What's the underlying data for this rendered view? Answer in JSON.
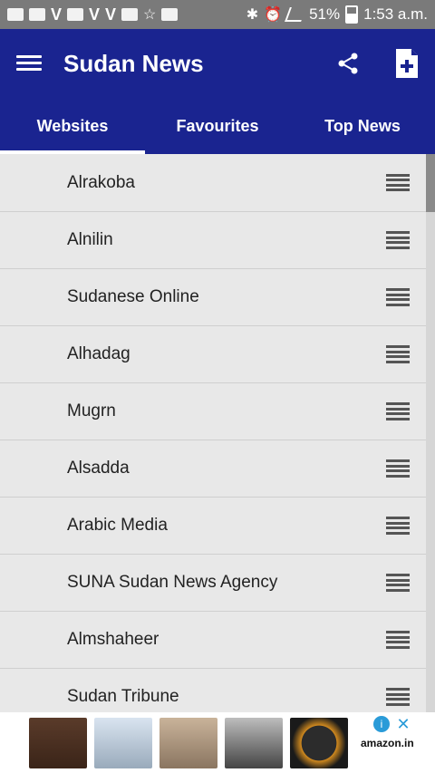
{
  "status_bar": {
    "battery": "51%",
    "time": "1:53 a.m."
  },
  "app_bar": {
    "title": "Sudan News",
    "menu_icon": "hamburger-icon",
    "share_icon": "share-icon",
    "add_icon": "add-document-icon"
  },
  "tabs": [
    {
      "label": "Websites",
      "active": true
    },
    {
      "label": "Favourites",
      "active": false
    },
    {
      "label": "Top News",
      "active": false
    }
  ],
  "list": [
    {
      "label": "Alrakoba"
    },
    {
      "label": "Alnilin"
    },
    {
      "label": "Sudanese Online"
    },
    {
      "label": "Alhadag"
    },
    {
      "label": "Mugrn"
    },
    {
      "label": "Alsadda"
    },
    {
      "label": "Arabic Media"
    },
    {
      "label": "SUNA Sudan News Agency"
    },
    {
      "label": "Almshaheer"
    },
    {
      "label": "Sudan Tribune"
    }
  ],
  "ad": {
    "brand": "amazon.in"
  },
  "colors": {
    "primary": "#1a2490",
    "statusbar": "#7a7a7a",
    "list_bg": "#e8e8e8"
  }
}
